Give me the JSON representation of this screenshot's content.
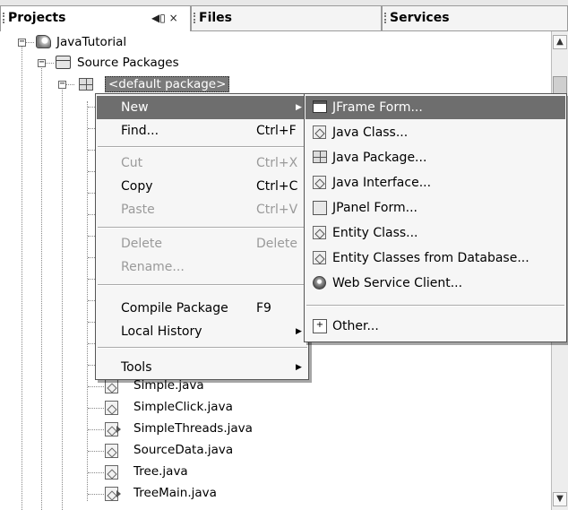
{
  "tabs": {
    "projects": "Projects",
    "projects_controls": "◀▯ ×",
    "files": "Files",
    "services": "Services"
  },
  "tree": {
    "project": "JavaTutorial",
    "source_packages": "Source Packages",
    "default_package": "<default package>",
    "files": [
      {
        "name": "Simple.java",
        "icon": "java-class-icon"
      },
      {
        "name": "SimpleClick.java",
        "icon": "java-class-icon"
      },
      {
        "name": "SimpleThreads.java",
        "icon": "java-main-class-icon"
      },
      {
        "name": "SourceData.java",
        "icon": "java-class-icon"
      },
      {
        "name": "Tree.java",
        "icon": "java-class-icon"
      },
      {
        "name": "TreeMain.java",
        "icon": "java-main-class-icon"
      }
    ]
  },
  "context_menu": {
    "new": "New",
    "find": "Find...",
    "find_shortcut": "Ctrl+F",
    "cut": "Cut",
    "cut_shortcut": "Ctrl+X",
    "copy": "Copy",
    "copy_shortcut": "Ctrl+C",
    "paste": "Paste",
    "paste_shortcut": "Ctrl+V",
    "delete": "Delete",
    "delete_shortcut": "Delete",
    "rename": "Rename...",
    "compile": "Compile Package",
    "compile_shortcut": "F9",
    "local_history": "Local History",
    "tools": "Tools"
  },
  "new_submenu": {
    "jframe": "JFrame Form...",
    "java_class": "Java Class...",
    "java_package": "Java Package...",
    "java_interface": "Java Interface...",
    "jpanel": "JPanel Form...",
    "entity_class": "Entity Class...",
    "entity_from_db": "Entity Classes from Database...",
    "ws_client": "Web Service Client...",
    "other": "Other..."
  },
  "colors": {
    "highlight": "#6e6e6e",
    "menu_bg": "#f6f6f6",
    "disabled_text": "#9a9a9a"
  }
}
